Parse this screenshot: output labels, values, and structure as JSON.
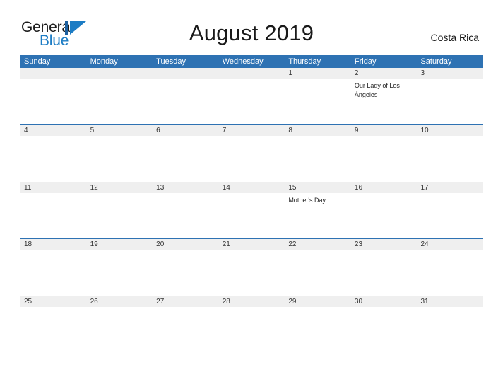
{
  "brand": {
    "word_one": "General",
    "word_two": "Blue",
    "mark_icon": "general-blue-triangle-logo",
    "accent_color": "#1C7CC4"
  },
  "header": {
    "title": "August 2019",
    "region": "Costa Rica"
  },
  "calendar": {
    "header_color": "#2E72B3",
    "date_band_color": "#EFEFEF",
    "weekdays": [
      "Sunday",
      "Monday",
      "Tuesday",
      "Wednesday",
      "Thursday",
      "Friday",
      "Saturday"
    ],
    "weeks": [
      {
        "days": [
          {
            "date": "",
            "event": ""
          },
          {
            "date": "",
            "event": ""
          },
          {
            "date": "",
            "event": ""
          },
          {
            "date": "",
            "event": ""
          },
          {
            "date": "1",
            "event": ""
          },
          {
            "date": "2",
            "event": "Our Lady of Los Ángeles"
          },
          {
            "date": "3",
            "event": ""
          }
        ]
      },
      {
        "days": [
          {
            "date": "4",
            "event": ""
          },
          {
            "date": "5",
            "event": ""
          },
          {
            "date": "6",
            "event": ""
          },
          {
            "date": "7",
            "event": ""
          },
          {
            "date": "8",
            "event": ""
          },
          {
            "date": "9",
            "event": ""
          },
          {
            "date": "10",
            "event": ""
          }
        ]
      },
      {
        "days": [
          {
            "date": "11",
            "event": ""
          },
          {
            "date": "12",
            "event": ""
          },
          {
            "date": "13",
            "event": ""
          },
          {
            "date": "14",
            "event": ""
          },
          {
            "date": "15",
            "event": "Mother's Day"
          },
          {
            "date": "16",
            "event": ""
          },
          {
            "date": "17",
            "event": ""
          }
        ]
      },
      {
        "days": [
          {
            "date": "18",
            "event": ""
          },
          {
            "date": "19",
            "event": ""
          },
          {
            "date": "20",
            "event": ""
          },
          {
            "date": "21",
            "event": ""
          },
          {
            "date": "22",
            "event": ""
          },
          {
            "date": "23",
            "event": ""
          },
          {
            "date": "24",
            "event": ""
          }
        ]
      },
      {
        "days": [
          {
            "date": "25",
            "event": ""
          },
          {
            "date": "26",
            "event": ""
          },
          {
            "date": "27",
            "event": ""
          },
          {
            "date": "28",
            "event": ""
          },
          {
            "date": "29",
            "event": ""
          },
          {
            "date": "30",
            "event": ""
          },
          {
            "date": "31",
            "event": ""
          }
        ]
      }
    ]
  }
}
